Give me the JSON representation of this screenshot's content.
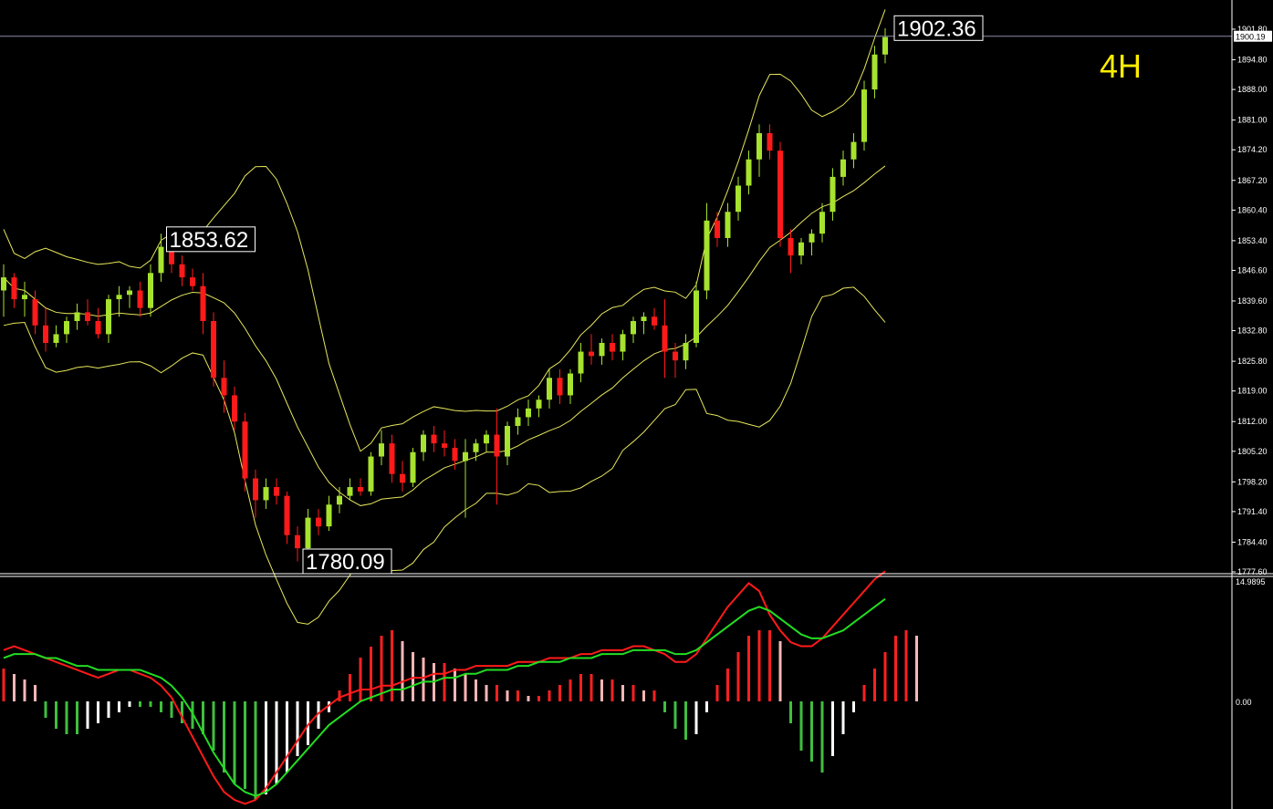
{
  "timeframe_label": "4H",
  "colors": {
    "background": "#000000",
    "bull": "#a6e22e",
    "bear": "#ff1a1a",
    "band": "#e6e65c",
    "timeframe": "#ffee00",
    "hist_pos_strong": "#ff2020",
    "hist_pos_weak": "#ffb6b6",
    "hist_neg_strong": "#3fbf3f",
    "hist_neg_weak": "#ffffff",
    "macd_fast": "#ff1a1a",
    "macd_signal": "#22dd22",
    "axis": "#ffffff"
  },
  "chart_data": [
    {
      "type": "candlestick",
      "price_axis": {
        "ticks": [
          "1901.80",
          "1894.80",
          "1888.00",
          "1881.00",
          "1874.20",
          "1867.20",
          "1860.40",
          "1853.40",
          "1846.60",
          "1839.60",
          "1832.80",
          "1825.80",
          "1819.00",
          "1812.00",
          "1805.20",
          "1798.20",
          "1791.40",
          "1784.40",
          "1777.60"
        ],
        "current_price": "1900.19",
        "ylim": [
          1777.6,
          1901.8
        ]
      },
      "annotations": [
        {
          "text": "1853.62",
          "value": 1853.62
        },
        {
          "text": "1780.09",
          "value": 1780.09
        },
        {
          "text": "1902.36",
          "value": 1902.36
        }
      ],
      "candles": [
        [
          1842,
          1848,
          1836,
          1845
        ],
        [
          1845,
          1846,
          1838,
          1840
        ],
        [
          1840,
          1844,
          1836,
          1841
        ],
        [
          1840,
          1842,
          1832,
          1834
        ],
        [
          1834,
          1838,
          1828,
          1830
        ],
        [
          1830,
          1834,
          1829,
          1832
        ],
        [
          1832,
          1836,
          1830,
          1835
        ],
        [
          1835,
          1839,
          1833,
          1837
        ],
        [
          1837,
          1840,
          1834,
          1835
        ],
        [
          1835,
          1838,
          1831,
          1832
        ],
        [
          1832,
          1841,
          1830,
          1840
        ],
        [
          1840,
          1843,
          1836,
          1841
        ],
        [
          1841,
          1843,
          1838,
          1842
        ],
        [
          1842,
          1844,
          1836,
          1838
        ],
        [
          1838,
          1848,
          1836,
          1846
        ],
        [
          1846,
          1855,
          1844,
          1852
        ],
        [
          1852,
          1854,
          1846,
          1848
        ],
        [
          1848,
          1850,
          1843,
          1845
        ],
        [
          1845,
          1847,
          1842,
          1843
        ],
        [
          1843,
          1846,
          1832,
          1835
        ],
        [
          1835,
          1837,
          1820,
          1822
        ],
        [
          1822,
          1826,
          1814,
          1818
        ],
        [
          1818,
          1820,
          1810,
          1812
        ],
        [
          1812,
          1814,
          1796,
          1799
        ],
        [
          1799,
          1801,
          1790,
          1794
        ],
        [
          1794,
          1799,
          1792,
          1797
        ],
        [
          1797,
          1799,
          1793,
          1795
        ],
        [
          1795,
          1796,
          1784,
          1786
        ],
        [
          1786,
          1788,
          1780,
          1783
        ],
        [
          1783,
          1792,
          1782,
          1790
        ],
        [
          1790,
          1792,
          1786,
          1788
        ],
        [
          1788,
          1795,
          1787,
          1793
        ],
        [
          1793,
          1797,
          1791,
          1795
        ],
        [
          1795,
          1799,
          1794,
          1797
        ],
        [
          1797,
          1799,
          1795,
          1796
        ],
        [
          1796,
          1805,
          1795,
          1804
        ],
        [
          1804,
          1810,
          1802,
          1807
        ],
        [
          1807,
          1809,
          1798,
          1800
        ],
        [
          1800,
          1803,
          1796,
          1798
        ],
        [
          1798,
          1806,
          1797,
          1805
        ],
        [
          1805,
          1810,
          1803,
          1809
        ],
        [
          1809,
          1811,
          1805,
          1807
        ],
        [
          1807,
          1810,
          1804,
          1806
        ],
        [
          1806,
          1808,
          1801,
          1803
        ],
        [
          1803,
          1808,
          1790,
          1805
        ],
        [
          1805,
          1808,
          1803,
          1807
        ],
        [
          1807,
          1810,
          1805,
          1809
        ],
        [
          1809,
          1815,
          1793,
          1804
        ],
        [
          1804,
          1812,
          1802,
          1811
        ],
        [
          1811,
          1815,
          1809,
          1813
        ],
        [
          1813,
          1817,
          1811,
          1815
        ],
        [
          1815,
          1818,
          1813,
          1817
        ],
        [
          1817,
          1824,
          1815,
          1822
        ],
        [
          1822,
          1824,
          1816,
          1818
        ],
        [
          1818,
          1824,
          1816,
          1823
        ],
        [
          1823,
          1830,
          1821,
          1828
        ],
        [
          1828,
          1832,
          1825,
          1827
        ],
        [
          1827,
          1831,
          1825,
          1830
        ],
        [
          1830,
          1832,
          1826,
          1828
        ],
        [
          1828,
          1833,
          1826,
          1832
        ],
        [
          1832,
          1836,
          1830,
          1835
        ],
        [
          1835,
          1837,
          1832,
          1836
        ],
        [
          1836,
          1838,
          1833,
          1834
        ],
        [
          1834,
          1840,
          1822,
          1828
        ],
        [
          1828,
          1830,
          1822,
          1826
        ],
        [
          1826,
          1832,
          1824,
          1830
        ],
        [
          1830,
          1844,
          1829,
          1842
        ],
        [
          1842,
          1862,
          1840,
          1858
        ],
        [
          1858,
          1860,
          1852,
          1854
        ],
        [
          1854,
          1862,
          1852,
          1860
        ],
        [
          1860,
          1868,
          1858,
          1866
        ],
        [
          1866,
          1874,
          1864,
          1872
        ],
        [
          1872,
          1880,
          1868,
          1878
        ],
        [
          1878,
          1880,
          1872,
          1874
        ],
        [
          1874,
          1876,
          1852,
          1854
        ],
        [
          1854,
          1856,
          1846,
          1850
        ],
        [
          1850,
          1854,
          1848,
          1853
        ],
        [
          1853,
          1856,
          1850,
          1855
        ],
        [
          1855,
          1862,
          1853,
          1860
        ],
        [
          1860,
          1870,
          1858,
          1868
        ],
        [
          1868,
          1874,
          1866,
          1872
        ],
        [
          1872,
          1878,
          1870,
          1876
        ],
        [
          1876,
          1890,
          1874,
          1888
        ],
        [
          1888,
          1898,
          1886,
          1896
        ],
        [
          1896,
          1902,
          1894,
          1900
        ]
      ]
    },
    {
      "type": "macd",
      "axis": {
        "ticks": [
          "14.9895",
          "0.00"
        ]
      },
      "histogram": [
        6,
        5,
        4,
        3,
        -3,
        -5,
        -6,
        -6,
        -5,
        -4,
        -3,
        -2,
        -1,
        -1,
        -1,
        -2,
        -3,
        -4,
        -5,
        -6,
        -9,
        -13,
        -15,
        -16,
        -18,
        -17,
        -15,
        -13,
        -10,
        -8,
        -5,
        -2,
        2,
        5,
        8,
        10,
        12,
        13,
        11,
        9,
        8,
        7,
        7,
        6,
        5,
        4,
        3,
        3,
        2,
        2,
        1,
        1,
        2,
        3,
        4,
        5,
        5,
        4,
        4,
        3,
        3,
        2,
        2,
        -2,
        -5,
        -7,
        -6,
        -2,
        3,
        6,
        9,
        12,
        13,
        13,
        11,
        -4,
        -9,
        -11,
        -13,
        -10,
        -6,
        -2,
        3,
        6,
        9,
        12,
        13,
        12
      ],
      "macd_line": [
        13,
        14,
        13,
        12,
        11,
        10,
        9,
        8,
        7,
        6,
        7,
        8,
        8,
        7,
        6,
        4,
        1,
        -4,
        -9,
        -14,
        -19,
        -23,
        -25,
        -26,
        -25,
        -22,
        -18,
        -14,
        -10,
        -6,
        -3,
        -1,
        1,
        2,
        3,
        3,
        4,
        4,
        5,
        6,
        6,
        7,
        7,
        8,
        8,
        9,
        9,
        9,
        9,
        10,
        10,
        10,
        11,
        11,
        11,
        12,
        12,
        13,
        13,
        13,
        14,
        14,
        13,
        12,
        10,
        10,
        12,
        16,
        20,
        24,
        27,
        30,
        28,
        22,
        18,
        15,
        14,
        14,
        16,
        19,
        22,
        25,
        28,
        31,
        33
      ],
      "signal_line": [
        11,
        12,
        12,
        12,
        11,
        11,
        10,
        9,
        9,
        8,
        8,
        8,
        8,
        8,
        7,
        6,
        4,
        1,
        -3,
        -8,
        -13,
        -17,
        -21,
        -23,
        -24,
        -23,
        -21,
        -18,
        -15,
        -12,
        -9,
        -6,
        -4,
        -2,
        0,
        1,
        2,
        3,
        3,
        4,
        5,
        5,
        6,
        6,
        7,
        7,
        8,
        8,
        8,
        9,
        9,
        10,
        10,
        10,
        11,
        11,
        11,
        12,
        12,
        12,
        13,
        13,
        13,
        13,
        12,
        12,
        13,
        15,
        17,
        19,
        21,
        23,
        24,
        23,
        21,
        19,
        17,
        16,
        16,
        17,
        18,
        20,
        22,
        24,
        26
      ]
    }
  ]
}
